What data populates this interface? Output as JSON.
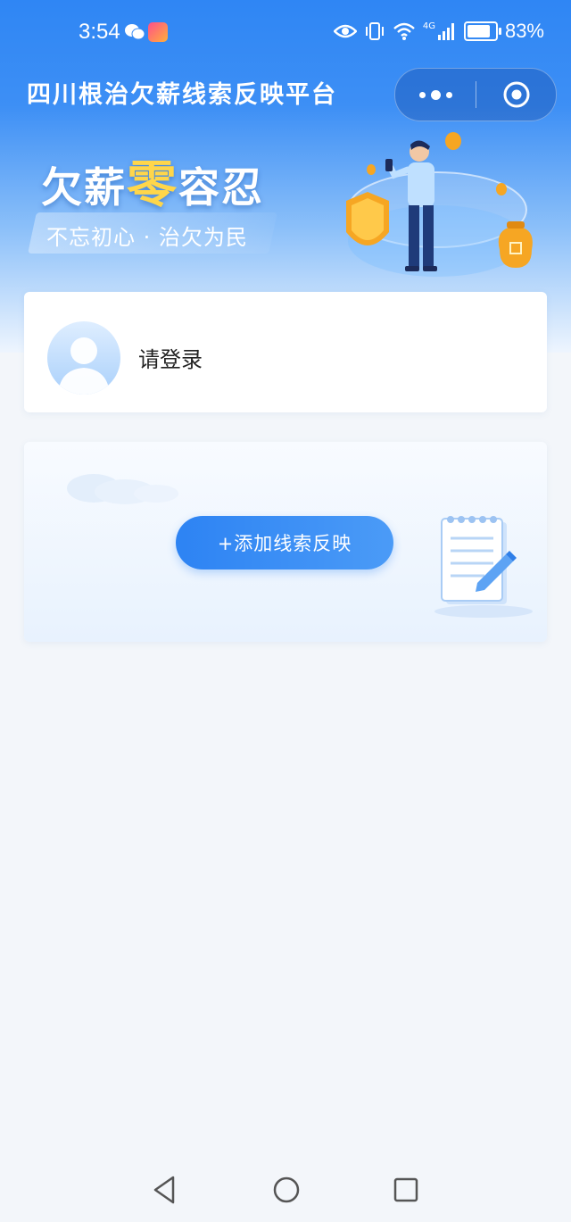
{
  "status_bar": {
    "time": "3:54",
    "network": "4G",
    "battery_text": "83%",
    "battery_level": 0.83
  },
  "title_bar": {
    "title": "四川根治欠薪线索反映平台",
    "more_icon": "more-dots-icon",
    "close_icon": "miniprogram-close-icon"
  },
  "banner": {
    "title_prefix": "欠薪",
    "title_highlight": "零",
    "title_suffix": "容忍",
    "subtitle": "不忘初心 · 治欠为民",
    "accent_color": "#ffd64a"
  },
  "user_card": {
    "login_text": "请登录",
    "avatar_icon": "user-avatar-icon"
  },
  "add_card": {
    "button_label": "+添加线索反映",
    "illustration_icon": "notepad-icon"
  },
  "nav_bar": {
    "back_icon": "back-triangle-icon",
    "home_icon": "home-circle-icon",
    "recents_icon": "recents-square-icon"
  },
  "colors": {
    "primary": "#2f86f4",
    "background": "#f3f6fa"
  }
}
